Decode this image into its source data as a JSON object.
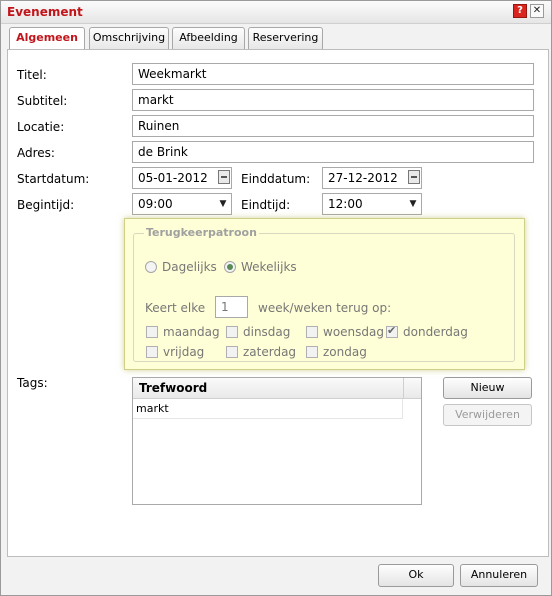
{
  "dialog": {
    "title": "Evenement"
  },
  "tabs": [
    "Algemeen",
    "Omschrijving",
    "Afbeelding",
    "Reservering"
  ],
  "form": {
    "titel_label": "Titel:",
    "titel_value": "Weekmarkt",
    "subtitel_label": "Subtitel:",
    "subtitel_value": "markt",
    "locatie_label": "Locatie:",
    "locatie_value": "Ruinen",
    "adres_label": "Adres:",
    "adres_value": "de Brink",
    "startdatum_label": "Startdatum:",
    "startdatum_value": "05-01-2012",
    "einddatum_label": "Einddatum:",
    "einddatum_value": "27-12-2012",
    "begintijd_label": "Begintijd:",
    "begintijd_value": "09:00",
    "eindtijd_label": "Eindtijd:",
    "eindtijd_value": "12:00",
    "tags_label": "Tags:"
  },
  "recurrence": {
    "legend": "Terugkeerpatroon",
    "daily_label": "Dagelijks",
    "weekly_label": "Wekelijks",
    "selected": "Wekelijks",
    "repeat_prefix": "Keert elke",
    "repeat_value": "1",
    "repeat_suffix": "week/weken terug op:",
    "days": [
      {
        "label": "maandag",
        "checked": false
      },
      {
        "label": "dinsdag",
        "checked": false
      },
      {
        "label": "woensdag",
        "checked": false
      },
      {
        "label": "donderdag",
        "checked": true
      },
      {
        "label": "vrijdag",
        "checked": false
      },
      {
        "label": "zaterdag",
        "checked": false
      },
      {
        "label": "zondag",
        "checked": false
      }
    ]
  },
  "tags": {
    "column_header": "Trefwoord",
    "rows": [
      "markt"
    ],
    "new_label": "Nieuw",
    "delete_label": "Verwijderen"
  },
  "footer": {
    "ok_label": "Ok",
    "cancel_label": "Annuleren"
  },
  "colors": {
    "title": "#c0151b",
    "popup_bg": "#ffffd7",
    "help_button": "#d9251d"
  }
}
